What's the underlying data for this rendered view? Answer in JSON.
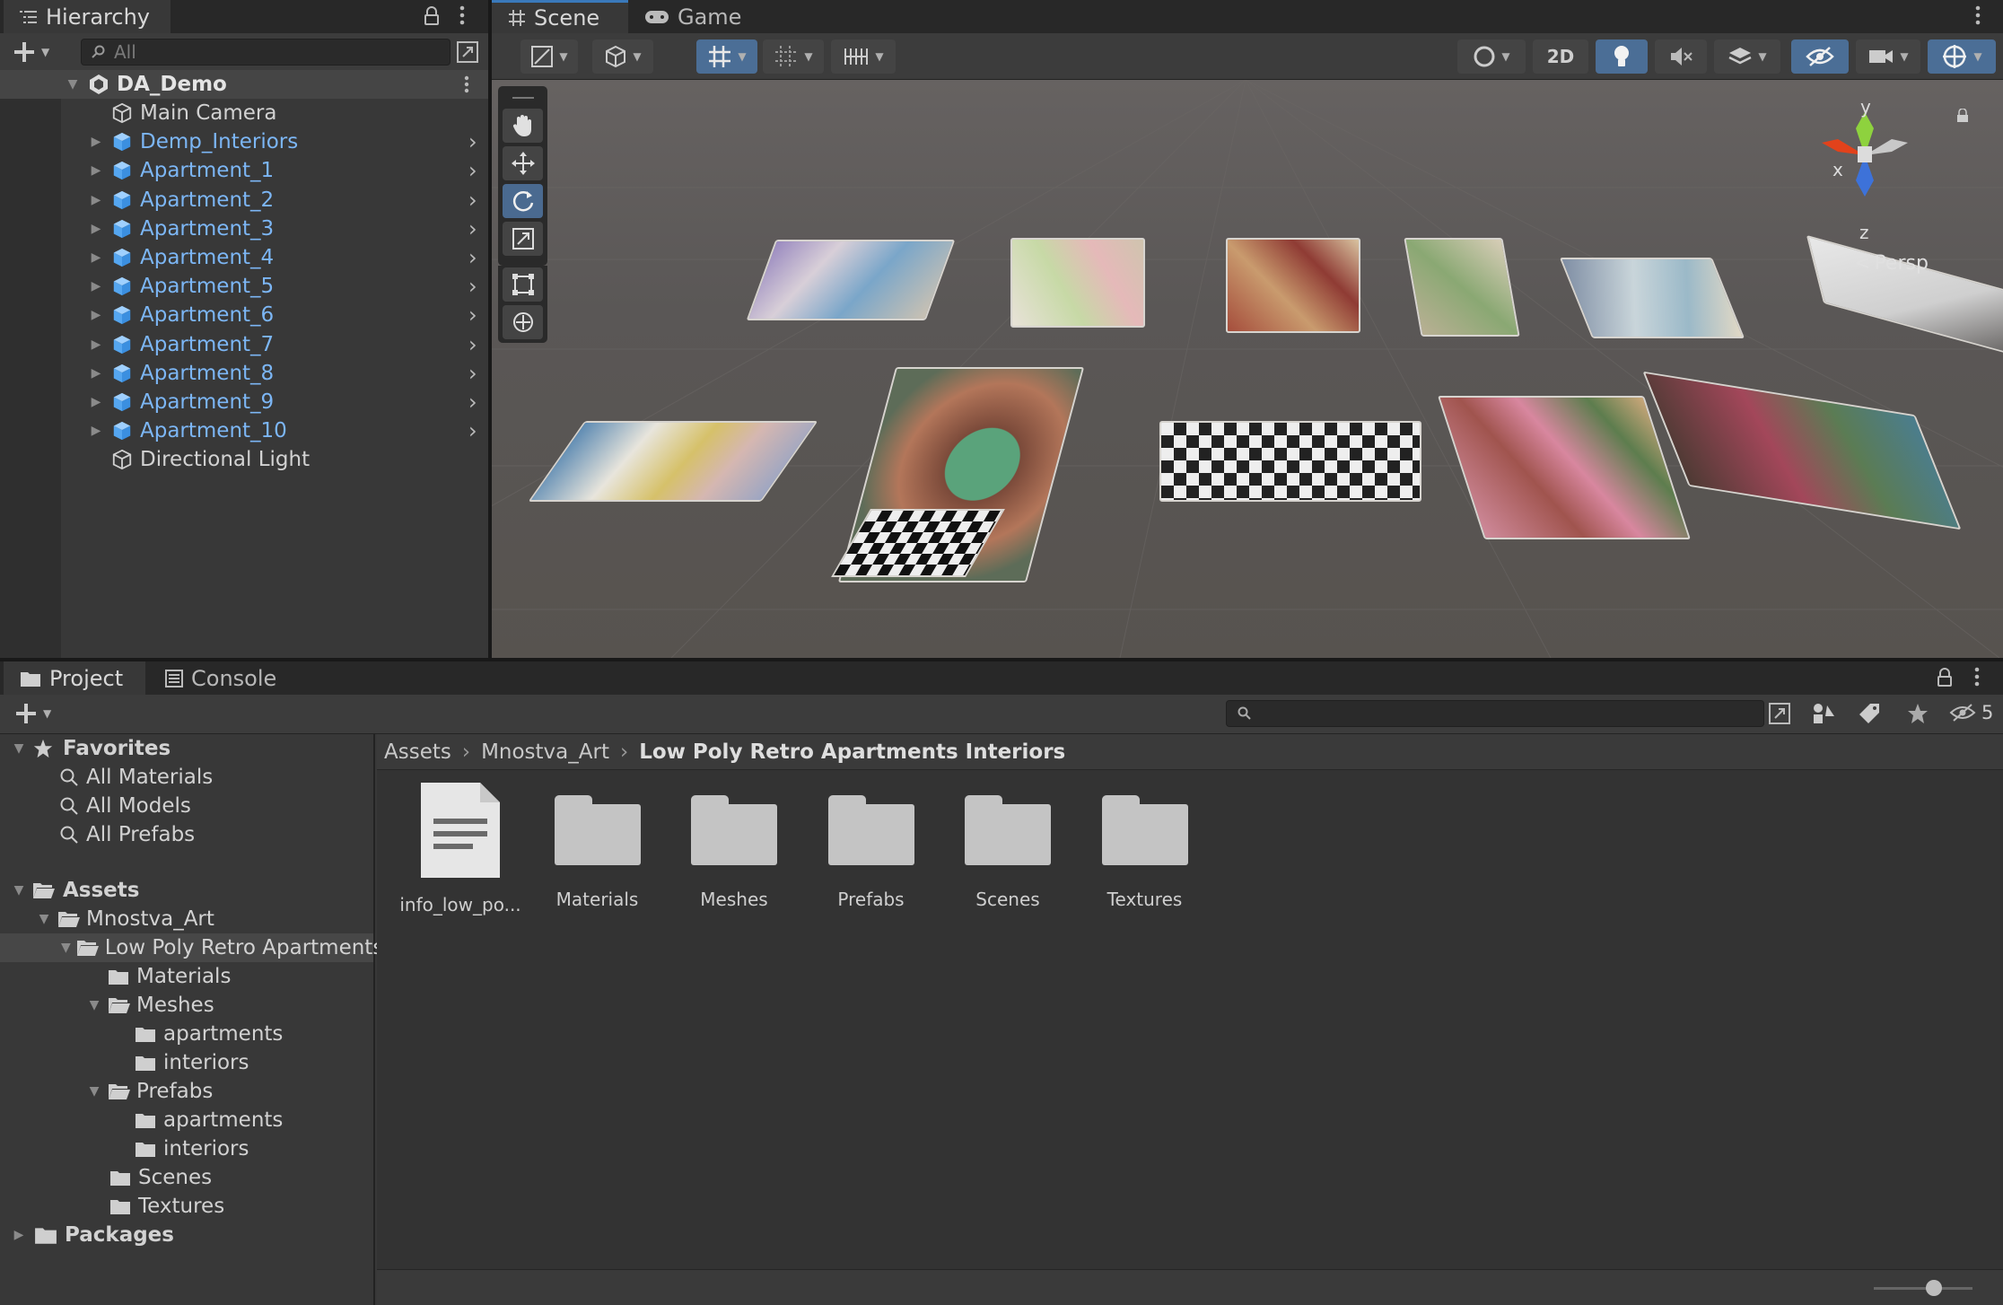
{
  "hierarchy": {
    "tab_label": "Hierarchy",
    "search_placeholder": "All",
    "root": "DA_Demo",
    "items": [
      {
        "label": "Main Camera",
        "prefab": false,
        "expandable": false
      },
      {
        "label": "Demp_Interiors",
        "prefab": true,
        "expandable": true
      },
      {
        "label": "Apartment_1",
        "prefab": true,
        "expandable": true
      },
      {
        "label": "Apartment_2",
        "prefab": true,
        "expandable": true
      },
      {
        "label": "Apartment_3",
        "prefab": true,
        "expandable": true
      },
      {
        "label": "Apartment_4",
        "prefab": true,
        "expandable": true
      },
      {
        "label": "Apartment_5",
        "prefab": true,
        "expandable": true
      },
      {
        "label": "Apartment_6",
        "prefab": true,
        "expandable": true
      },
      {
        "label": "Apartment_7",
        "prefab": true,
        "expandable": true
      },
      {
        "label": "Apartment_8",
        "prefab": true,
        "expandable": true
      },
      {
        "label": "Apartment_9",
        "prefab": true,
        "expandable": true
      },
      {
        "label": "Apartment_10",
        "prefab": true,
        "expandable": true
      },
      {
        "label": "Directional Light",
        "prefab": false,
        "expandable": false
      }
    ]
  },
  "scene": {
    "tabs": {
      "scene": "Scene",
      "game": "Game"
    },
    "toolbar": {
      "twod_label": "2D"
    },
    "gizmo": {
      "x": "x",
      "y": "y",
      "z": "z",
      "persp": "Persp"
    }
  },
  "project": {
    "tabs": {
      "project": "Project",
      "console": "Console"
    },
    "hidden_count": "5",
    "favorites": {
      "label": "Favorites",
      "items": [
        "All Materials",
        "All Models",
        "All Prefabs"
      ]
    },
    "tree": {
      "assets": "Assets",
      "mnostva": "Mnostva_Art",
      "low_poly": "Low Poly Retro Apartments Interiors",
      "materials": "Materials",
      "meshes": "Meshes",
      "meshes_apartments": "apartments",
      "meshes_interiors": "interiors",
      "prefabs": "Prefabs",
      "prefabs_apartments": "apartments",
      "prefabs_interiors": "interiors",
      "scenes": "Scenes",
      "textures": "Textures",
      "packages": "Packages"
    },
    "breadcrumb": [
      "Assets",
      "Mnostva_Art",
      "Low Poly Retro Apartments Interiors"
    ],
    "assets": [
      {
        "label": "info_low_po...",
        "kind": "file"
      },
      {
        "label": "Materials",
        "kind": "folder"
      },
      {
        "label": "Meshes",
        "kind": "folder"
      },
      {
        "label": "Prefabs",
        "kind": "folder"
      },
      {
        "label": "Scenes",
        "kind": "folder"
      },
      {
        "label": "Textures",
        "kind": "folder"
      }
    ]
  },
  "colors": {
    "accent": "#3a79bb",
    "prefab_blue": "#7cb6f5",
    "panel": "#383838",
    "scene_bg": "#5d5a58"
  }
}
